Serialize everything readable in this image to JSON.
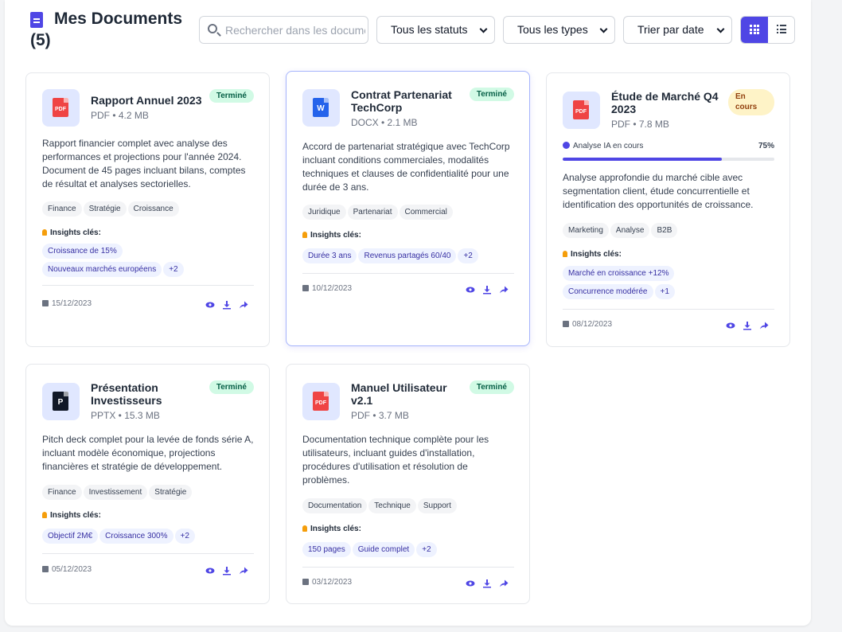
{
  "header": {
    "title": "Mes Documents",
    "count": "(5)",
    "search_placeholder": "Rechercher dans les documents...",
    "filter_status": "Tous les statuts",
    "filter_type": "Tous les types",
    "sort": "Trier par date",
    "view_mode": "grid"
  },
  "labels": {
    "insights": "Insights clés:",
    "ai_progress": "Analyse IA en cours"
  },
  "colors": {
    "accent": "#4f46e5",
    "done_bg": "#d1fae5",
    "progress_bg": "#fef3c7"
  },
  "documents": [
    {
      "title": "Rapport Annuel 2023",
      "type": "PDF",
      "meta": "PDF • 4.2 MB",
      "status": "Terminé",
      "icon": "pdf-file-icon",
      "description": "Rapport financier complet avec analyse des performances et projections pour l'année 2024. Document de 45 pages incluant bilans, comptes de résultat et analyses sectorielles.",
      "tags": [
        "Finance",
        "Stratégie",
        "Croissance"
      ],
      "insights": [
        "Croissance de 15%",
        "Nouveaux marchés européens",
        "+2"
      ],
      "date": "15/12/2023"
    },
    {
      "title": "Contrat Partenariat TechCorp",
      "type": "W",
      "meta": "DOCX • 2.1 MB",
      "status": "Terminé",
      "icon": "word-file-icon",
      "description": "Accord de partenariat stratégique avec TechCorp incluant conditions commerciales, modalités techniques et clauses de confidentialité pour une durée de 3 ans.",
      "tags": [
        "Juridique",
        "Partenariat",
        "Commercial"
      ],
      "insights": [
        "Durée 3 ans",
        "Revenus partagés 60/40",
        "+2"
      ],
      "date": "10/12/2023"
    },
    {
      "title": "Étude de Marché Q4 2023",
      "type": "PDF",
      "meta": "PDF • 7.8 MB",
      "status": "En cours",
      "icon": "pdf-file-icon",
      "progress_pct": "75%",
      "progress": 0.75,
      "description": "Analyse approfondie du marché cible avec segmentation client, étude concurrentielle et identification des opportunités de croissance.",
      "tags": [
        "Marketing",
        "Analyse",
        "B2B"
      ],
      "insights": [
        "Marché en croissance +12%",
        "Concurrence modérée",
        "+1"
      ],
      "date": "08/12/2023"
    },
    {
      "title": "Présentation Investisseurs",
      "type": "P",
      "meta": "PPTX • 15.3 MB",
      "status": "Terminé",
      "icon": "powerpoint-file-icon",
      "description": "Pitch deck complet pour la levée de fonds série A, incluant modèle économique, projections financières et stratégie de développement.",
      "tags": [
        "Finance",
        "Investissement",
        "Stratégie"
      ],
      "insights": [
        "Objectif 2M€",
        "Croissance 300%",
        "+2"
      ],
      "date": "05/12/2023"
    },
    {
      "title": "Manuel Utilisateur v2.1",
      "type": "PDF",
      "meta": "PDF • 3.7 MB",
      "status": "Terminé",
      "icon": "pdf-file-icon",
      "description": "Documentation technique complète pour les utilisateurs, incluant guides d'installation, procédures d'utilisation et résolution de problèmes.",
      "tags": [
        "Documentation",
        "Technique",
        "Support"
      ],
      "insights": [
        "150 pages",
        "Guide complet",
        "+2"
      ],
      "date": "03/12/2023"
    }
  ]
}
